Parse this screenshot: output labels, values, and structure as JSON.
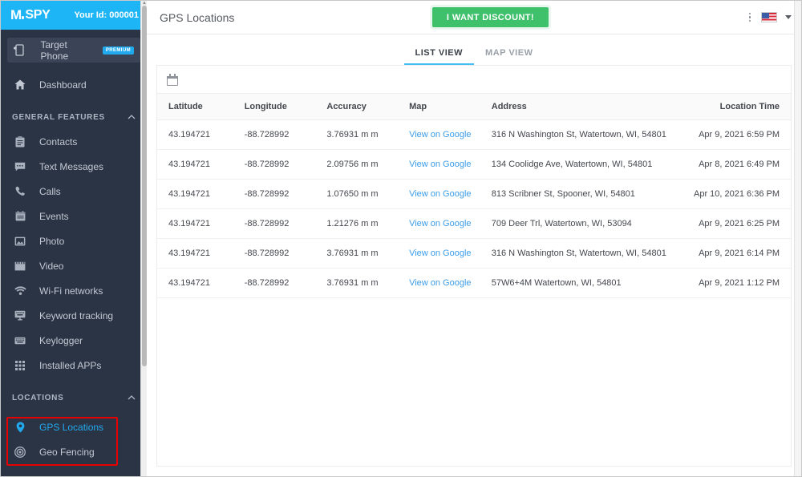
{
  "sidebar": {
    "logo": {
      "m": "M",
      "spy": "SPY"
    },
    "user_id": "Your Id: 000001",
    "target_phone": {
      "label": "Target Phone",
      "badge": "PREMIUM"
    },
    "dashboard": "Dashboard",
    "general_section": "GENERAL FEATURES",
    "general_items": [
      {
        "label": "Contacts",
        "icon": "clipboard-icon"
      },
      {
        "label": "Text Messages",
        "icon": "message-icon"
      },
      {
        "label": "Calls",
        "icon": "phone-icon"
      },
      {
        "label": "Events",
        "icon": "calendar-icon"
      },
      {
        "label": "Photo",
        "icon": "image-icon"
      },
      {
        "label": "Video",
        "icon": "video-icon"
      },
      {
        "label": "Wi-Fi networks",
        "icon": "wifi-icon"
      },
      {
        "label": "Keyword tracking",
        "icon": "keyword-icon"
      },
      {
        "label": "Keylogger",
        "icon": "keyboard-icon"
      },
      {
        "label": "Installed APPs",
        "icon": "grid-icon"
      }
    ],
    "locations_section": "LOCATIONS",
    "location_items": [
      {
        "label": "GPS Locations",
        "icon": "map-pin-icon",
        "active": true
      },
      {
        "label": "Geo Fencing",
        "icon": "target-icon",
        "active": false
      }
    ]
  },
  "topbar": {
    "title": "GPS Locations",
    "discount_button": "I WANT DISCOUNT!",
    "language_flag": "us-flag-icon"
  },
  "tabs": [
    {
      "label": "LIST VIEW",
      "active": true
    },
    {
      "label": "MAP VIEW",
      "active": false
    }
  ],
  "table": {
    "columns": [
      "Latitude",
      "Longitude",
      "Accuracy",
      "Map",
      "Address",
      "Location Time"
    ],
    "map_link_label": "View on Google",
    "rows": [
      {
        "latitude": "43.194721",
        "longitude": "-88.728992",
        "accuracy": "3.76931 m m",
        "map": "View on Google",
        "address": "316 N Washington St, Watertown, WI, 54801",
        "location_time": "Apr 9, 2021 6:59 PM"
      },
      {
        "latitude": "43.194721",
        "longitude": "-88.728992",
        "accuracy": "2.09756 m m",
        "map": "View on Google",
        "address": "134 Coolidge Ave, Watertown, WI, 54801",
        "location_time": "Apr 8, 2021 6:49 PM"
      },
      {
        "latitude": "43.194721",
        "longitude": "-88.728992",
        "accuracy": "1.07650 m m",
        "map": "View on Google",
        "address": "813 Scribner St, Spooner, WI, 54801",
        "location_time": "Apr 10, 2021 6:36 PM"
      },
      {
        "latitude": "43.194721",
        "longitude": "-88.728992",
        "accuracy": "1.21276 m m",
        "map": "View on Google",
        "address": "709 Deer Trl, Watertown, WI, 53094",
        "location_time": "Apr 9, 2021 6:25 PM"
      },
      {
        "latitude": "43.194721",
        "longitude": "-88.728992",
        "accuracy": "3.76931 m m",
        "map": "View on Google",
        "address": "316 N Washington St, Watertown, WI, 54801",
        "location_time": "Apr 9, 2021 6:14 PM"
      },
      {
        "latitude": "43.194721",
        "longitude": "-88.728992",
        "accuracy": "3.76931 m m",
        "map": "View on Google",
        "address": "57W6+4M Watertown, WI, 54801",
        "location_time": "Apr 9, 2021 1:12 PM"
      }
    ]
  },
  "colors": {
    "brand_cyan": "#1eb5f7",
    "sidebar_bg": "#2b3444",
    "accent_green": "#3fc06a",
    "link_blue": "#3d9de8",
    "highlight_red": "#e60000"
  }
}
